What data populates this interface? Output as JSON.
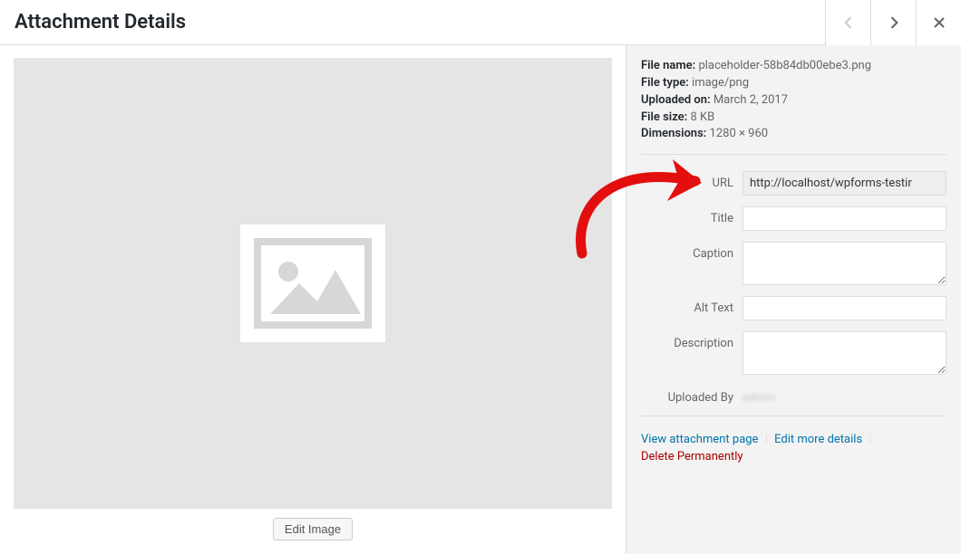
{
  "header": {
    "title": "Attachment Details"
  },
  "meta": {
    "file_name_label": "File name:",
    "file_name": "placeholder-58b84db00ebe3.png",
    "file_type_label": "File type:",
    "file_type": "image/png",
    "uploaded_on_label": "Uploaded on:",
    "uploaded_on": "March 2, 2017",
    "file_size_label": "File size:",
    "file_size": "8 KB",
    "dimensions_label": "Dimensions:",
    "dimensions": "1280 × 960"
  },
  "edit_image_label": "Edit Image",
  "settings": {
    "url_label": "URL",
    "url_value": "http://localhost/wpforms-testir",
    "title_label": "Title",
    "title_value": "",
    "caption_label": "Caption",
    "caption_value": "",
    "alt_label": "Alt Text",
    "alt_value": "",
    "description_label": "Description",
    "description_value": "",
    "uploaded_by_label": "Uploaded By",
    "uploaded_by_value": "admin"
  },
  "actions": {
    "view_page": "View attachment page",
    "edit_more": "Edit more details",
    "delete": "Delete Permanently"
  }
}
